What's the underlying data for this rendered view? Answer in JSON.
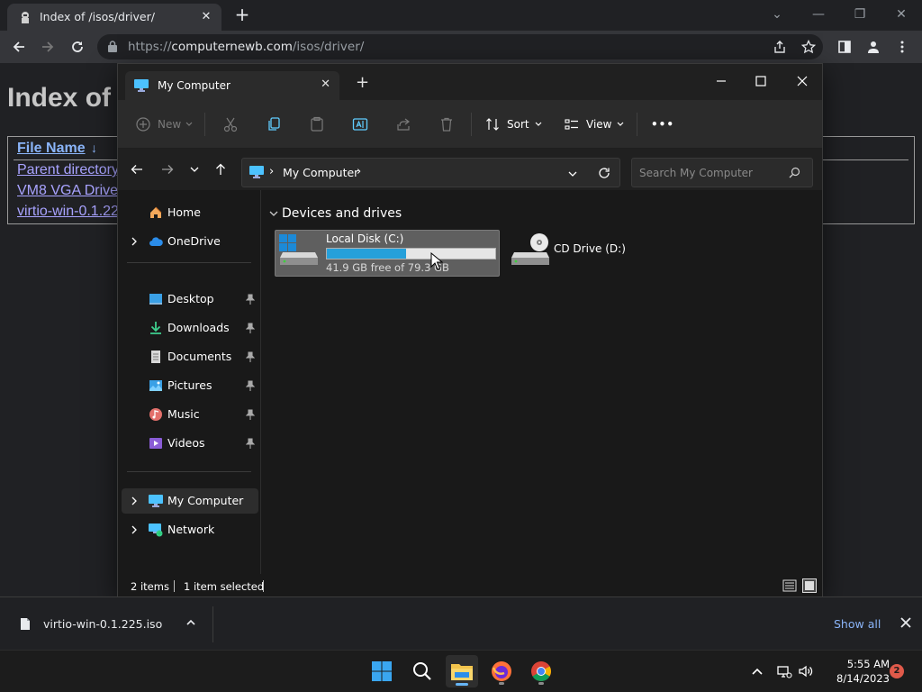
{
  "browser": {
    "tab_title": "Index of /isos/driver/",
    "url_prefix": "https://",
    "url_host": "computernewb.com",
    "url_path": "/isos/driver/"
  },
  "webpage": {
    "heading": "Index of",
    "column_header": "File Name",
    "sort_arrow": "↓",
    "rows": [
      {
        "name": "Parent directory"
      },
      {
        "name": "VM8 VGA Drive"
      },
      {
        "name": "virtio-win-0.1.22"
      }
    ]
  },
  "explorer": {
    "tab_title": "My Computer",
    "commands": {
      "new": "New",
      "sort": "Sort",
      "view": "View",
      "more": "•••"
    },
    "address": {
      "path": "My Computer",
      "separator": "›"
    },
    "search_placeholder": "Search My Computer",
    "nav": {
      "home": "Home",
      "onedrive": "OneDrive",
      "pinned": [
        "Desktop",
        "Downloads",
        "Documents",
        "Pictures",
        "Music",
        "Videos"
      ],
      "my_computer": "My Computer",
      "network": "Network"
    },
    "group_header": "Devices and drives",
    "drives": [
      {
        "name": "Local Disk (C:)",
        "free_text": "41.9 GB free of 79.3 GB",
        "used_fraction": 0.47
      },
      {
        "name": "CD Drive (D:)"
      }
    ],
    "status": {
      "items": "2 items",
      "selected": "1 item selected"
    }
  },
  "download_shelf": {
    "file": "virtio-win-0.1.225.iso",
    "show_all": "Show all"
  },
  "taskbar": {
    "time": "5:55 AM",
    "date": "8/14/2023",
    "notifications": "2"
  },
  "colors": {
    "accent": "#26a0da",
    "link": "#8ab4f8",
    "visited_link": "#a8a3ff",
    "notification": "#e05a4a"
  }
}
